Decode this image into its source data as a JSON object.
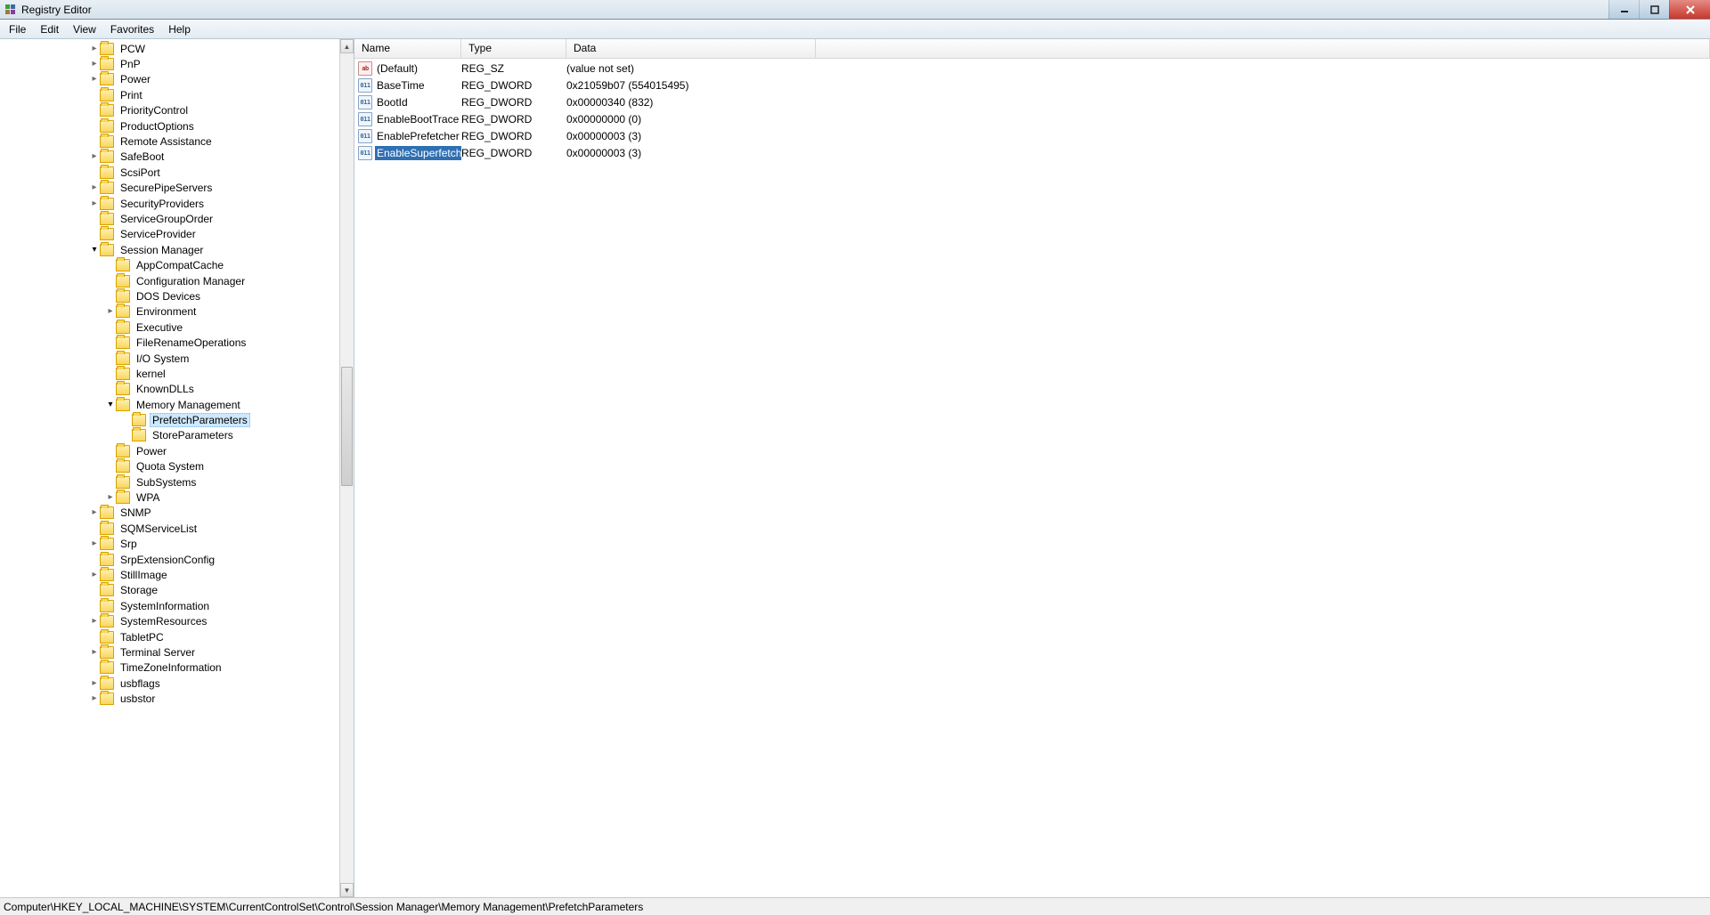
{
  "window": {
    "title": "Registry Editor"
  },
  "menu": {
    "items": [
      "File",
      "Edit",
      "View",
      "Favorites",
      "Help"
    ]
  },
  "tree": {
    "baseIndent": 100,
    "rows": [
      {
        "indent": 0,
        "expander": "closed",
        "label": "PCW"
      },
      {
        "indent": 0,
        "expander": "closed",
        "label": "PnP"
      },
      {
        "indent": 0,
        "expander": "closed",
        "label": "Power"
      },
      {
        "indent": 0,
        "expander": "none",
        "label": "Print"
      },
      {
        "indent": 0,
        "expander": "none",
        "label": "PriorityControl"
      },
      {
        "indent": 0,
        "expander": "none",
        "label": "ProductOptions"
      },
      {
        "indent": 0,
        "expander": "none",
        "label": "Remote Assistance"
      },
      {
        "indent": 0,
        "expander": "closed",
        "label": "SafeBoot"
      },
      {
        "indent": 0,
        "expander": "none",
        "label": "ScsiPort"
      },
      {
        "indent": 0,
        "expander": "closed",
        "label": "SecurePipeServers"
      },
      {
        "indent": 0,
        "expander": "closed",
        "label": "SecurityProviders"
      },
      {
        "indent": 0,
        "expander": "none",
        "label": "ServiceGroupOrder"
      },
      {
        "indent": 0,
        "expander": "none",
        "label": "ServiceProvider"
      },
      {
        "indent": 0,
        "expander": "open",
        "label": "Session Manager"
      },
      {
        "indent": 1,
        "expander": "none",
        "label": "AppCompatCache"
      },
      {
        "indent": 1,
        "expander": "none",
        "label": "Configuration Manager"
      },
      {
        "indent": 1,
        "expander": "none",
        "label": "DOS Devices"
      },
      {
        "indent": 1,
        "expander": "closed",
        "label": "Environment"
      },
      {
        "indent": 1,
        "expander": "none",
        "label": "Executive"
      },
      {
        "indent": 1,
        "expander": "none",
        "label": "FileRenameOperations"
      },
      {
        "indent": 1,
        "expander": "none",
        "label": "I/O System"
      },
      {
        "indent": 1,
        "expander": "none",
        "label": "kernel"
      },
      {
        "indent": 1,
        "expander": "none",
        "label": "KnownDLLs"
      },
      {
        "indent": 1,
        "expander": "open",
        "label": "Memory Management"
      },
      {
        "indent": 2,
        "expander": "none",
        "label": "PrefetchParameters",
        "selected": true
      },
      {
        "indent": 2,
        "expander": "none",
        "label": "StoreParameters"
      },
      {
        "indent": 1,
        "expander": "none",
        "label": "Power"
      },
      {
        "indent": 1,
        "expander": "none",
        "label": "Quota System"
      },
      {
        "indent": 1,
        "expander": "none",
        "label": "SubSystems"
      },
      {
        "indent": 1,
        "expander": "closed",
        "label": "WPA"
      },
      {
        "indent": 0,
        "expander": "closed",
        "label": "SNMP"
      },
      {
        "indent": 0,
        "expander": "none",
        "label": "SQMServiceList"
      },
      {
        "indent": 0,
        "expander": "closed",
        "label": "Srp"
      },
      {
        "indent": 0,
        "expander": "none",
        "label": "SrpExtensionConfig"
      },
      {
        "indent": 0,
        "expander": "closed",
        "label": "StillImage"
      },
      {
        "indent": 0,
        "expander": "none",
        "label": "Storage"
      },
      {
        "indent": 0,
        "expander": "none",
        "label": "SystemInformation"
      },
      {
        "indent": 0,
        "expander": "closed",
        "label": "SystemResources"
      },
      {
        "indent": 0,
        "expander": "none",
        "label": "TabletPC"
      },
      {
        "indent": 0,
        "expander": "closed",
        "label": "Terminal Server"
      },
      {
        "indent": 0,
        "expander": "none",
        "label": "TimeZoneInformation"
      },
      {
        "indent": 0,
        "expander": "closed",
        "label": "usbflags"
      },
      {
        "indent": 0,
        "expander": "closed",
        "label": "usbstor"
      }
    ]
  },
  "columns": {
    "name": "Name",
    "type": "Type",
    "data": "Data"
  },
  "values": [
    {
      "icon": "str",
      "name": "(Default)",
      "type": "REG_SZ",
      "data": "(value not set)"
    },
    {
      "icon": "bin",
      "name": "BaseTime",
      "type": "REG_DWORD",
      "data": "0x21059b07 (554015495)"
    },
    {
      "icon": "bin",
      "name": "BootId",
      "type": "REG_DWORD",
      "data": "0x00000340 (832)"
    },
    {
      "icon": "bin",
      "name": "EnableBootTrace",
      "type": "REG_DWORD",
      "data": "0x00000000 (0)"
    },
    {
      "icon": "bin",
      "name": "EnablePrefetcher",
      "type": "REG_DWORD",
      "data": "0x00000003 (3)"
    },
    {
      "icon": "bin",
      "name": "EnableSuperfetch",
      "type": "REG_DWORD",
      "data": "0x00000003 (3)",
      "selected": true
    }
  ],
  "statusbar": {
    "path": "Computer\\HKEY_LOCAL_MACHINE\\SYSTEM\\CurrentControlSet\\Control\\Session Manager\\Memory Management\\PrefetchParameters"
  }
}
